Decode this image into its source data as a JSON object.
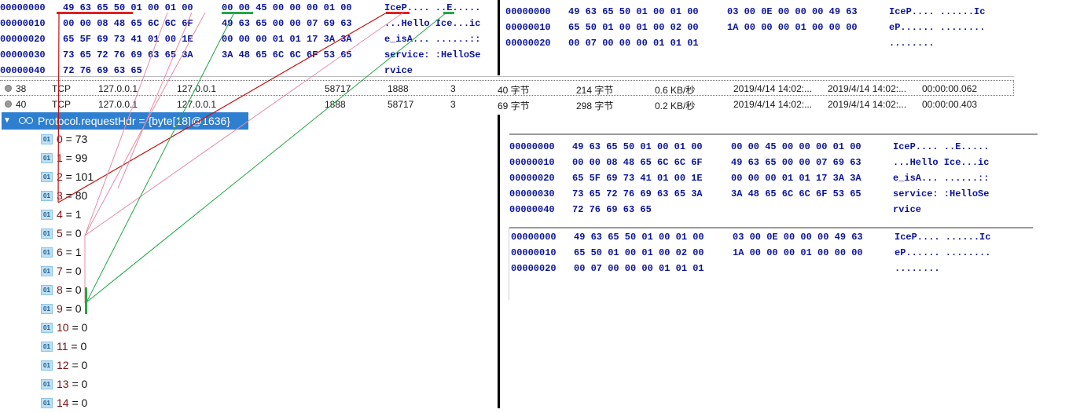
{
  "hex_top_left": {
    "rows": [
      {
        "addr": "00000000",
        "g1": "49 63 65 50 01 00 01 00",
        "g2": "00 00 45 00 00 00 01 00",
        "ascii": "IceP.... ..E....."
      },
      {
        "addr": "00000010",
        "g1": "00 00 08 48 65 6C 6C 6F",
        "g2": "49 63 65 00 00 07 69 63",
        "ascii": "...Hello Ice...ic"
      },
      {
        "addr": "00000020",
        "g1": "65 5F 69 73 41 01 00 1E",
        "g2": "00 00 00 01 01 17 3A 3A",
        "ascii": "e_isA... ......::"
      },
      {
        "addr": "00000030",
        "g1": "73 65 72 76 69 63 65 3A",
        "g2": "3A 48 65 6C 6C 6F 53 65",
        "ascii": "service: :HelloSe"
      },
      {
        "addr": "00000040",
        "g1": "72 76 69 63 65",
        "g2": "",
        "ascii": "rvice"
      }
    ]
  },
  "hex_top_right": {
    "rows": [
      {
        "addr": "00000000",
        "g1": "49 63 65 50 01 00 01 00",
        "g2": "03 00 0E 00 00 00 49 63",
        "ascii": "IceP.... ......Ic"
      },
      {
        "addr": "00000010",
        "g1": "65 50 01 00 01 00 02 00",
        "g2": "1A 00 00 00 01 00 00 00",
        "ascii": "eP...... ........"
      },
      {
        "addr": "00000020",
        "g1": "00 07 00 00 00 01 01 01",
        "g2": "",
        "ascii": "........"
      }
    ]
  },
  "hex_mid_right": {
    "rows": [
      {
        "addr": "00000000",
        "g1": "49 63 65 50 01 00 01 00",
        "g2": "00 00 45 00 00 00 01 00",
        "ascii": "IceP.... ..E....."
      },
      {
        "addr": "00000010",
        "g1": "00 00 08 48 65 6C 6C 6F",
        "g2": "49 63 65 00 00 07 69 63",
        "ascii": "...Hello Ice...ic"
      },
      {
        "addr": "00000020",
        "g1": "65 5F 69 73 41 01 00 1E",
        "g2": "00 00 00 01 01 17 3A 3A",
        "ascii": "e_isA... ......::"
      },
      {
        "addr": "00000030",
        "g1": "73 65 72 76 69 63 65 3A",
        "g2": "3A 48 65 6C 6C 6F 53 65",
        "ascii": "service: :HelloSe"
      },
      {
        "addr": "00000040",
        "g1": "72 76 69 63 65",
        "g2": "",
        "ascii": "rvice"
      }
    ]
  },
  "hex_bottom_right": {
    "rows": [
      {
        "addr": "00000000",
        "g1": "49 63 65 50 01 00 01 00",
        "g2": "03 00 0E 00 00 00 49 63",
        "ascii": "IceP.... ......Ic"
      },
      {
        "addr": "00000010",
        "g1": "65 50 01 00 01 00 02 00",
        "g2": "1A 00 00 00 01 00 00 00",
        "ascii": "eP...... ........"
      },
      {
        "addr": "00000020",
        "g1": "00 07 00 00 00 01 01 01",
        "g2": "",
        "ascii": "........"
      }
    ]
  },
  "packets": [
    {
      "no": "38",
      "proto": "TCP",
      "src": "127.0.0.1",
      "dst": "127.0.0.1",
      "sport": "58717",
      "dport": "1888",
      "count": "3",
      "payload": "40 字节",
      "total": "214 字节",
      "rate": "0.6 KB/秒",
      "start": "2019/4/14 14:02:...",
      "end": "2019/4/14 14:02:...",
      "dur": "00:00:00.062"
    },
    {
      "no": "40",
      "proto": "TCP",
      "src": "127.0.0.1",
      "dst": "127.0.0.1",
      "sport": "1888",
      "dport": "58717",
      "count": "3",
      "payload": "69 字节",
      "total": "298 字节",
      "rate": "0.2 KB/秒",
      "start": "2019/4/14 14:02:...",
      "end": "2019/4/14 14:02:...",
      "dur": "00:00:00.403"
    }
  ],
  "tree": {
    "header_label": "Protocol.requestHdr = {byte[18]@1636}",
    "badge": "01",
    "items": [
      {
        "index": "0",
        "value": "73"
      },
      {
        "index": "1",
        "value": "99"
      },
      {
        "index": "2",
        "value": "101"
      },
      {
        "index": "3",
        "value": "80"
      },
      {
        "index": "4",
        "value": "1"
      },
      {
        "index": "5",
        "value": "0"
      },
      {
        "index": "6",
        "value": "1"
      },
      {
        "index": "7",
        "value": "0"
      },
      {
        "index": "8",
        "value": "0"
      },
      {
        "index": "9",
        "value": "0"
      },
      {
        "index": "10",
        "value": "0"
      },
      {
        "index": "11",
        "value": "0"
      },
      {
        "index": "12",
        "value": "0"
      },
      {
        "index": "13",
        "value": "0"
      },
      {
        "index": "14",
        "value": "0"
      }
    ]
  },
  "colors": {
    "hex_text": "#0a149c",
    "highlight_red": "#e02020",
    "highlight_green": "#22a844",
    "selection": "#2f7fd0"
  }
}
